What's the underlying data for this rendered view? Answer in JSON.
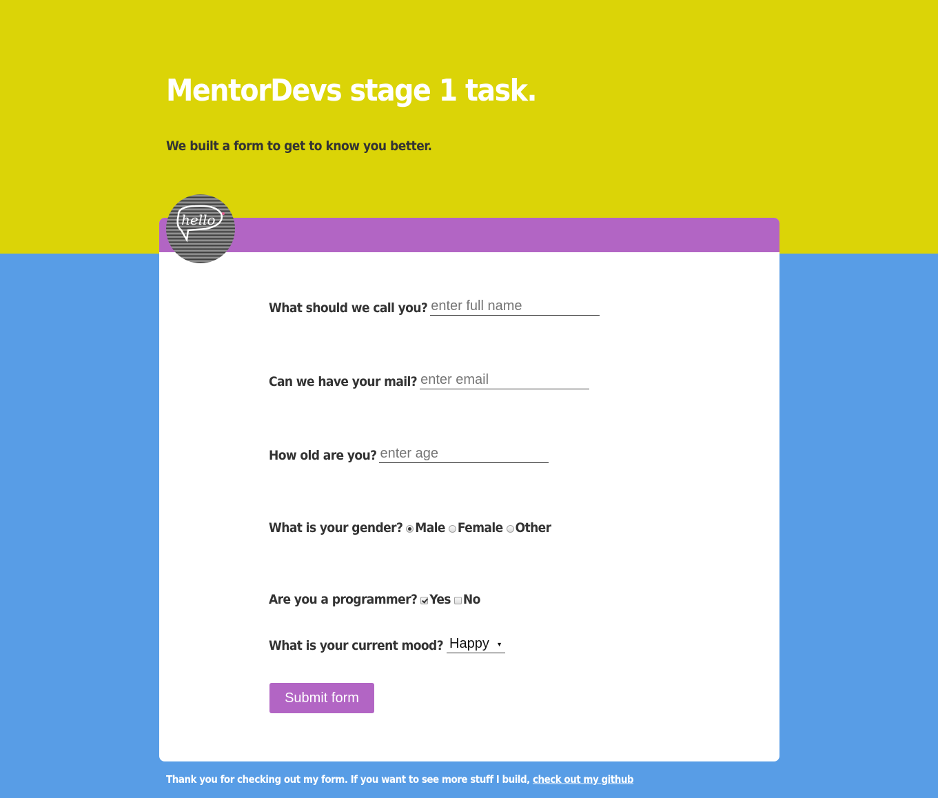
{
  "header": {
    "title": "MentorDevs stage 1 task.",
    "subtitle": "We built a form to get to know you better."
  },
  "avatar": {
    "text": "hello"
  },
  "form": {
    "name": {
      "label": "What should we call you?",
      "placeholder": "enter full name"
    },
    "email": {
      "label": "Can we have your mail?",
      "placeholder": "enter email"
    },
    "age": {
      "label": "How old are you?",
      "placeholder": "enter age"
    },
    "gender": {
      "label": "What is your gender?",
      "options": [
        {
          "label": "Male",
          "checked": true
        },
        {
          "label": "Female",
          "checked": false
        },
        {
          "label": "Other",
          "checked": false
        }
      ]
    },
    "programmer": {
      "label": "Are you a programmer?",
      "options": [
        {
          "label": "Yes",
          "checked": true
        },
        {
          "label": "No",
          "checked": false
        }
      ]
    },
    "mood": {
      "label": "What is your current mood?",
      "selected": "Happy"
    },
    "submit_label": "Submit form"
  },
  "footer": {
    "text": "Thank you for checking out my form. If you want to see more stuff I build, ",
    "link_text": "check out my github"
  },
  "colors": {
    "header_bg": "#dbd407",
    "page_bg": "#589de6",
    "accent": "#b265c4",
    "card_bg": "#ffffff"
  }
}
